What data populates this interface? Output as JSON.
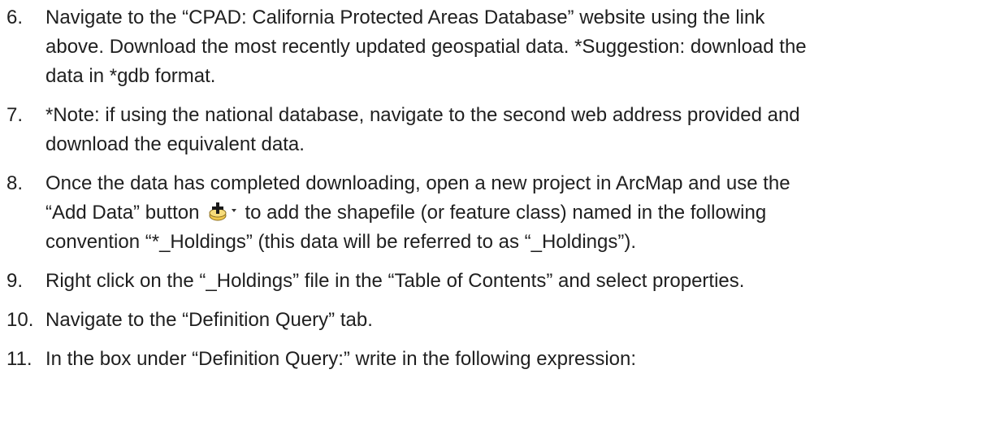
{
  "steps": [
    {
      "number": "6.",
      "lines": [
        "Navigate to the “CPAD: California Protected Areas Database” website using the link",
        "above. Download the most recently updated geospatial data. *Suggestion: download the",
        "data in *gdb format."
      ]
    },
    {
      "number": "7.",
      "lines": [
        "*Note: if using the national database, navigate to the second web address provided  and",
        "download the equivalent data."
      ]
    },
    {
      "number": "8.",
      "line1": "Once the data has completed downloading, open a new project in ArcMap and use the",
      "line2_before": "“Add Data” button",
      "line2_after": "to add the shapefile (or feature class)  named in the following",
      "line3": "convention “*_Holdings”  (this data will be referred to as “_Holdings”).",
      "button_icon": "add-data-icon"
    },
    {
      "number": "9.",
      "lines": [
        "Right click on the “_Holdings”   file in the “Table of Contents” and select properties."
      ]
    },
    {
      "number": "10.",
      "lines": [
        "Navigate to the “Definition Query” tab."
      ]
    },
    {
      "number": "11.",
      "lines": [
        "In the box under “Definition Query:” write in the following expression:"
      ]
    }
  ],
  "colors": {
    "text": "#1f1f1f",
    "icon_fill": "#f2c94c",
    "icon_stroke": "#8a6d1f"
  }
}
